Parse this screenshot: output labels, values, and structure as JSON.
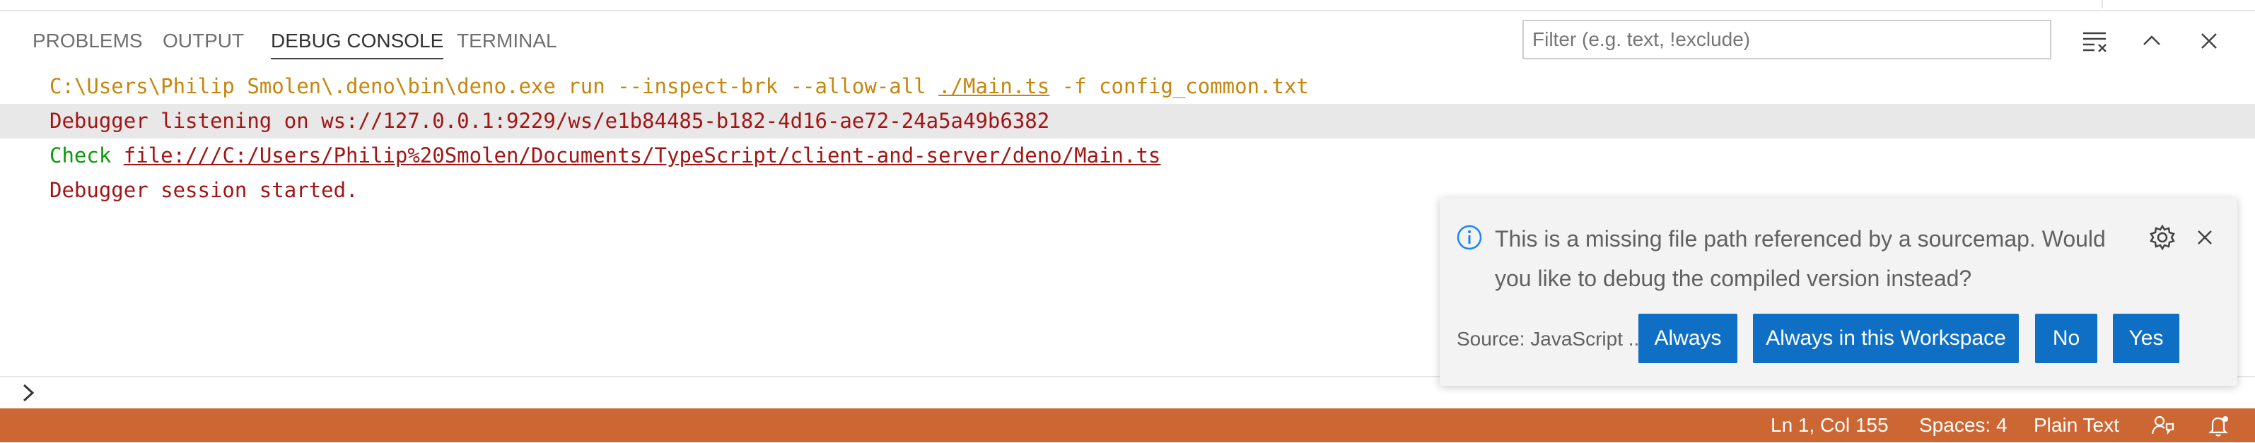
{
  "tabs": {
    "problems": "PROBLEMS",
    "output": "OUTPUT",
    "debug_console": "DEBUG CONSOLE",
    "terminal": "TERMINAL"
  },
  "filter": {
    "placeholder": "Filter (e.g. text, !exclude)",
    "value": ""
  },
  "panel_icons": [
    "clear-console-icon",
    "chevron-up-icon",
    "close-icon"
  ],
  "console": {
    "line1": {
      "before": "C:\\Users\\Philip Smolen\\.deno\\bin\\deno.exe run --inspect-brk --allow-all ",
      "link": "./Main.ts",
      "after": " -f config_common.txt"
    },
    "line2": "Debugger listening on ws://127.0.0.1:9229/ws/e1b84485-b182-4d16-ae72-24a5a49b6382",
    "line3": {
      "prefix": "Check ",
      "link": "file:///C:/Users/Philip%20Smolen/Documents/TypeScript/client-and-server/deno/Main.ts"
    },
    "line4": "Debugger session started."
  },
  "notification": {
    "message": "This is a missing file path referenced by a sourcemap. Would you like to debug the compiled version instead?",
    "source": "Source: JavaScript ...",
    "buttons": {
      "always": "Always",
      "always_workspace": "Always in this Workspace",
      "no": "No",
      "yes": "Yes"
    }
  },
  "statusbar": {
    "position": "Ln 1, Col 155",
    "spaces": "Spaces: 4",
    "language": "Plain Text"
  },
  "colors": {
    "statusbar": "#cc6633",
    "button": "#0e6fc4",
    "command_text": "#c6860d",
    "error_text": "#a31515",
    "check_text": "#0d9b0d"
  }
}
